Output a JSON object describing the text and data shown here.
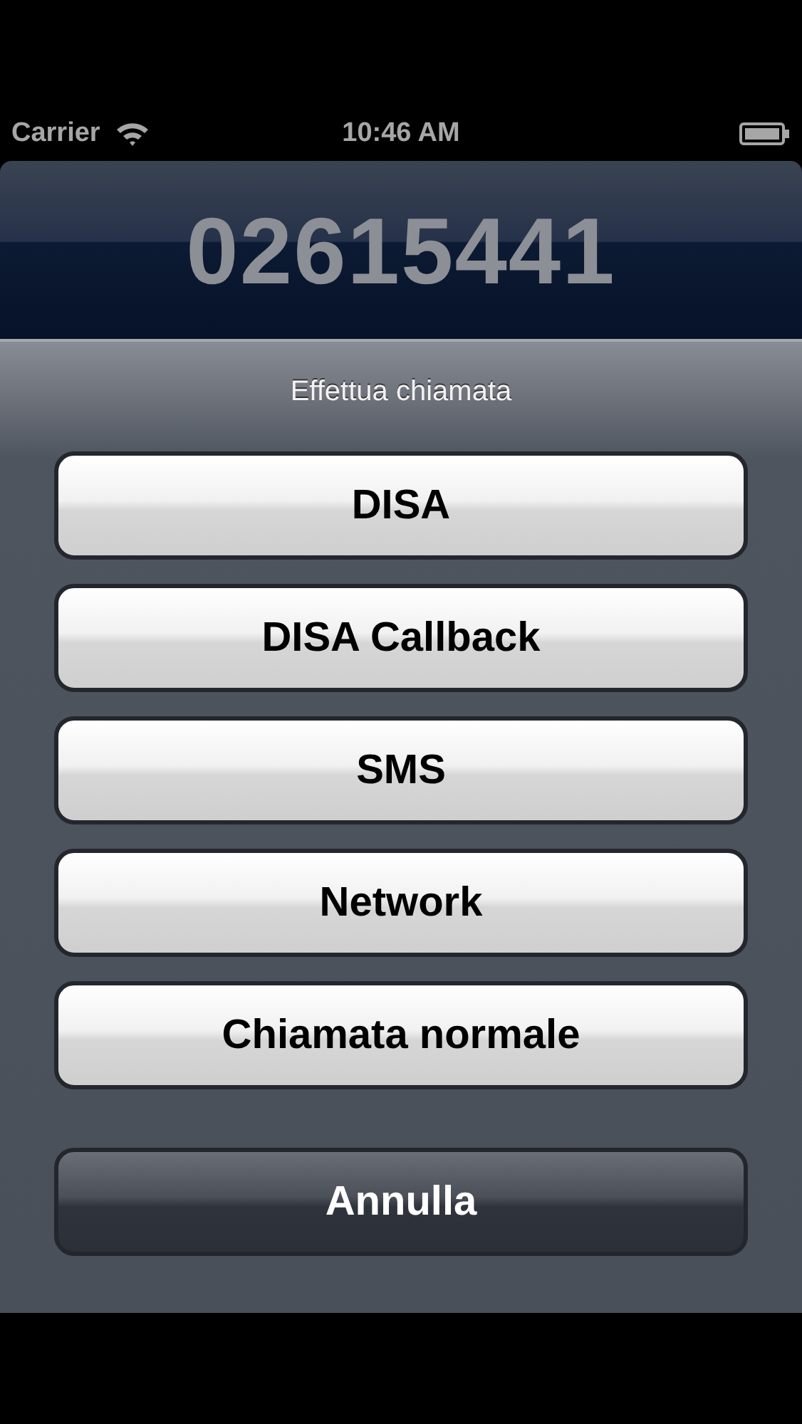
{
  "status_bar": {
    "carrier": "Carrier",
    "time": "10:46 AM"
  },
  "display": {
    "number": "02615441"
  },
  "action_sheet": {
    "title": "Effettua chiamata",
    "options": [
      {
        "label": "DISA",
        "kind": "default"
      },
      {
        "label": "DISA Callback",
        "kind": "default"
      },
      {
        "label": "SMS",
        "kind": "default"
      },
      {
        "label": "Network",
        "kind": "default"
      },
      {
        "label": "Chiamata normale",
        "kind": "default"
      },
      {
        "label": "Annulla",
        "kind": "cancel"
      }
    ]
  }
}
